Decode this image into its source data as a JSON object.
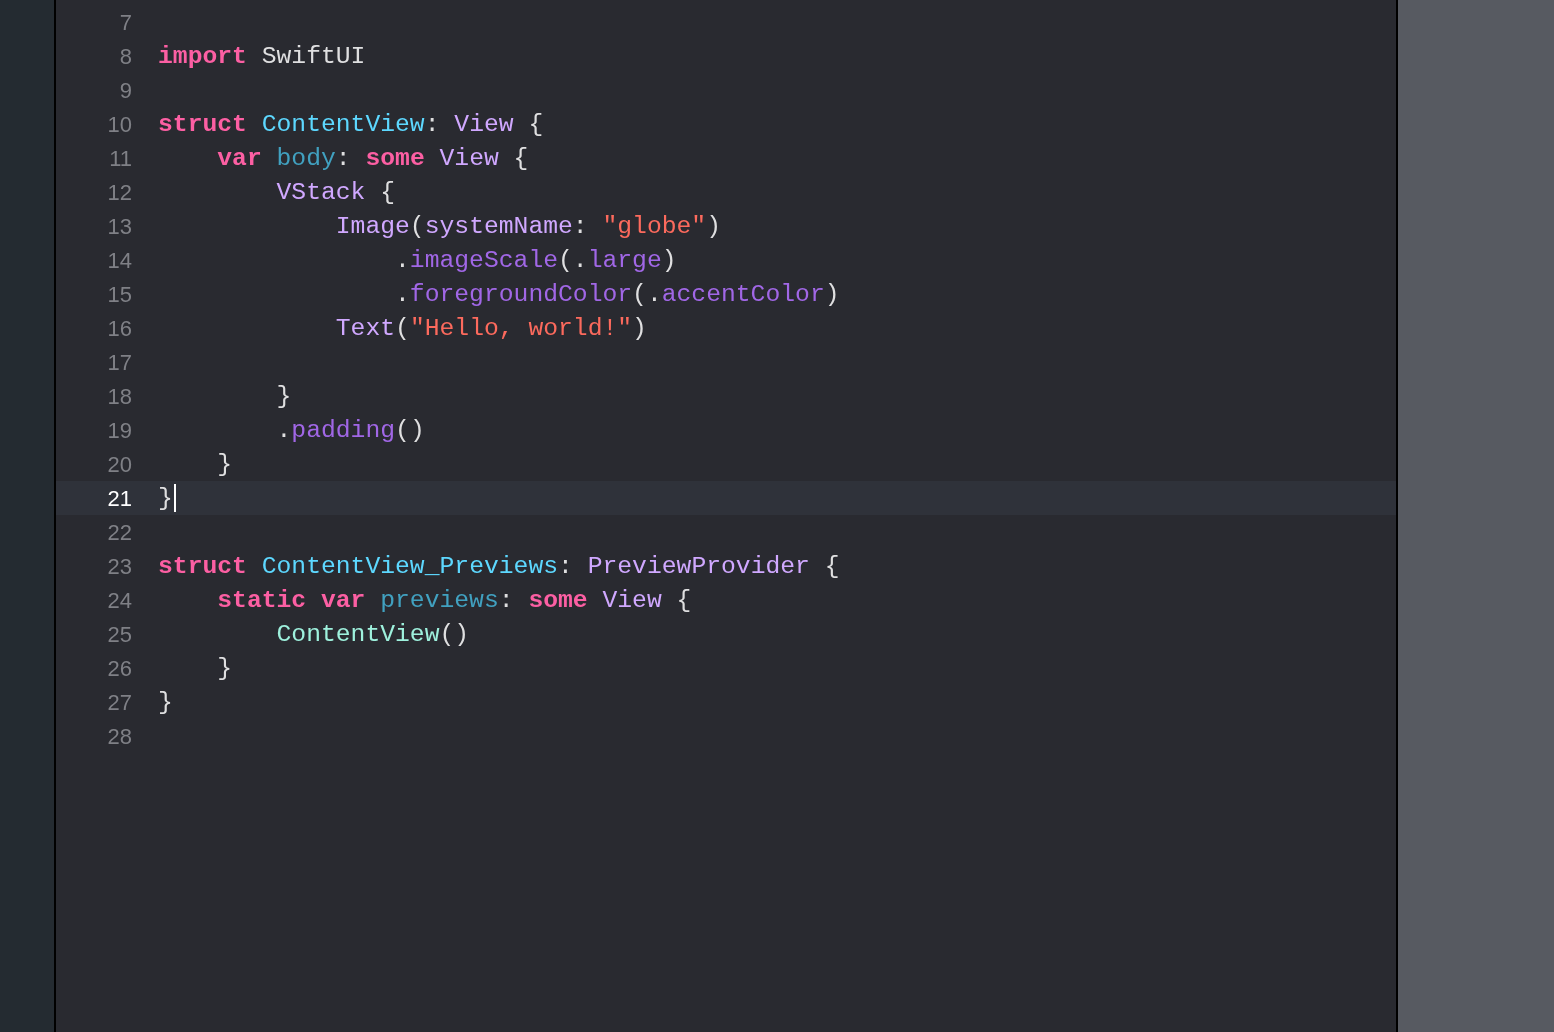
{
  "editor": {
    "lines": [
      {
        "number": "7",
        "current": false
      },
      {
        "number": "8",
        "current": false,
        "tokens": [
          {
            "text": "import",
            "kind": "keyword"
          },
          {
            "text": " SwiftUI",
            "kind": "plain"
          }
        ]
      },
      {
        "number": "9",
        "current": false
      },
      {
        "number": "10",
        "current": false,
        "tokens": [
          {
            "text": "struct ",
            "kind": "keyword"
          },
          {
            "text": "ContentView",
            "kind": "type_decl"
          },
          {
            "text": ": ",
            "kind": "plain"
          },
          {
            "text": "View",
            "kind": "type"
          },
          {
            "text": " {",
            "kind": "plain"
          }
        ]
      },
      {
        "number": "11",
        "current": false,
        "tokens": [
          {
            "text": "    var ",
            "kind": "keyword"
          },
          {
            "text": "body",
            "kind": "var_decl"
          },
          {
            "text": ": ",
            "kind": "plain"
          },
          {
            "text": "some ",
            "kind": "keyword"
          },
          {
            "text": "View",
            "kind": "type"
          },
          {
            "text": " {",
            "kind": "plain"
          }
        ]
      },
      {
        "number": "12",
        "current": false,
        "tokens": [
          {
            "text": "        VStack",
            "kind": "type"
          },
          {
            "text": " {",
            "kind": "plain"
          }
        ]
      },
      {
        "number": "13",
        "current": false,
        "tokens": [
          {
            "text": "            Image",
            "kind": "type"
          },
          {
            "text": "(",
            "kind": "plain"
          },
          {
            "text": "systemName",
            "kind": "type"
          },
          {
            "text": ": ",
            "kind": "plain"
          },
          {
            "text": "\"globe\"",
            "kind": "string"
          },
          {
            "text": ")",
            "kind": "plain"
          }
        ]
      },
      {
        "number": "14",
        "current": false,
        "tokens": [
          {
            "text": "                .",
            "kind": "plain"
          },
          {
            "text": "imageScale",
            "kind": "member"
          },
          {
            "text": "(.",
            "kind": "plain"
          },
          {
            "text": "large",
            "kind": "member"
          },
          {
            "text": ")",
            "kind": "plain"
          }
        ]
      },
      {
        "number": "15",
        "current": false,
        "tokens": [
          {
            "text": "                .",
            "kind": "plain"
          },
          {
            "text": "foregroundColor",
            "kind": "member"
          },
          {
            "text": "(.",
            "kind": "plain"
          },
          {
            "text": "accentColor",
            "kind": "member"
          },
          {
            "text": ")",
            "kind": "plain"
          }
        ]
      },
      {
        "number": "16",
        "current": false,
        "tokens": [
          {
            "text": "            Text",
            "kind": "type"
          },
          {
            "text": "(",
            "kind": "plain"
          },
          {
            "text": "\"Hello, world!\"",
            "kind": "string"
          },
          {
            "text": ")",
            "kind": "plain"
          }
        ]
      },
      {
        "number": "17",
        "current": false
      },
      {
        "number": "18",
        "current": false,
        "tokens": [
          {
            "text": "        }",
            "kind": "plain"
          }
        ]
      },
      {
        "number": "19",
        "current": false,
        "tokens": [
          {
            "text": "        .",
            "kind": "plain"
          },
          {
            "text": "padding",
            "kind": "member"
          },
          {
            "text": "()",
            "kind": "plain"
          }
        ]
      },
      {
        "number": "20",
        "current": false,
        "tokens": [
          {
            "text": "    }",
            "kind": "plain"
          }
        ]
      },
      {
        "number": "21",
        "current": true,
        "tokens": [
          {
            "text": "}",
            "kind": "plain"
          }
        ]
      },
      {
        "number": "22",
        "current": false
      },
      {
        "number": "23",
        "current": false,
        "tokens": [
          {
            "text": "struct ",
            "kind": "keyword"
          },
          {
            "text": "ContentView_Previews",
            "kind": "type_decl"
          },
          {
            "text": ": ",
            "kind": "plain"
          },
          {
            "text": "PreviewProvider",
            "kind": "type"
          },
          {
            "text": " {",
            "kind": "plain"
          }
        ]
      },
      {
        "number": "24",
        "current": false,
        "tokens": [
          {
            "text": "    static var ",
            "kind": "keyword"
          },
          {
            "text": "previews",
            "kind": "var_decl"
          },
          {
            "text": ": ",
            "kind": "plain"
          },
          {
            "text": "some ",
            "kind": "keyword"
          },
          {
            "text": "View",
            "kind": "type"
          },
          {
            "text": " {",
            "kind": "plain"
          }
        ]
      },
      {
        "number": "25",
        "current": false,
        "tokens": [
          {
            "text": "        ContentView",
            "kind": "project_type"
          },
          {
            "text": "()",
            "kind": "plain"
          }
        ]
      },
      {
        "number": "26",
        "current": false,
        "tokens": [
          {
            "text": "    }",
            "kind": "plain"
          }
        ]
      },
      {
        "number": "27",
        "current": false,
        "tokens": [
          {
            "text": "}",
            "kind": "plain"
          }
        ]
      },
      {
        "number": "28",
        "current": false
      }
    ]
  }
}
